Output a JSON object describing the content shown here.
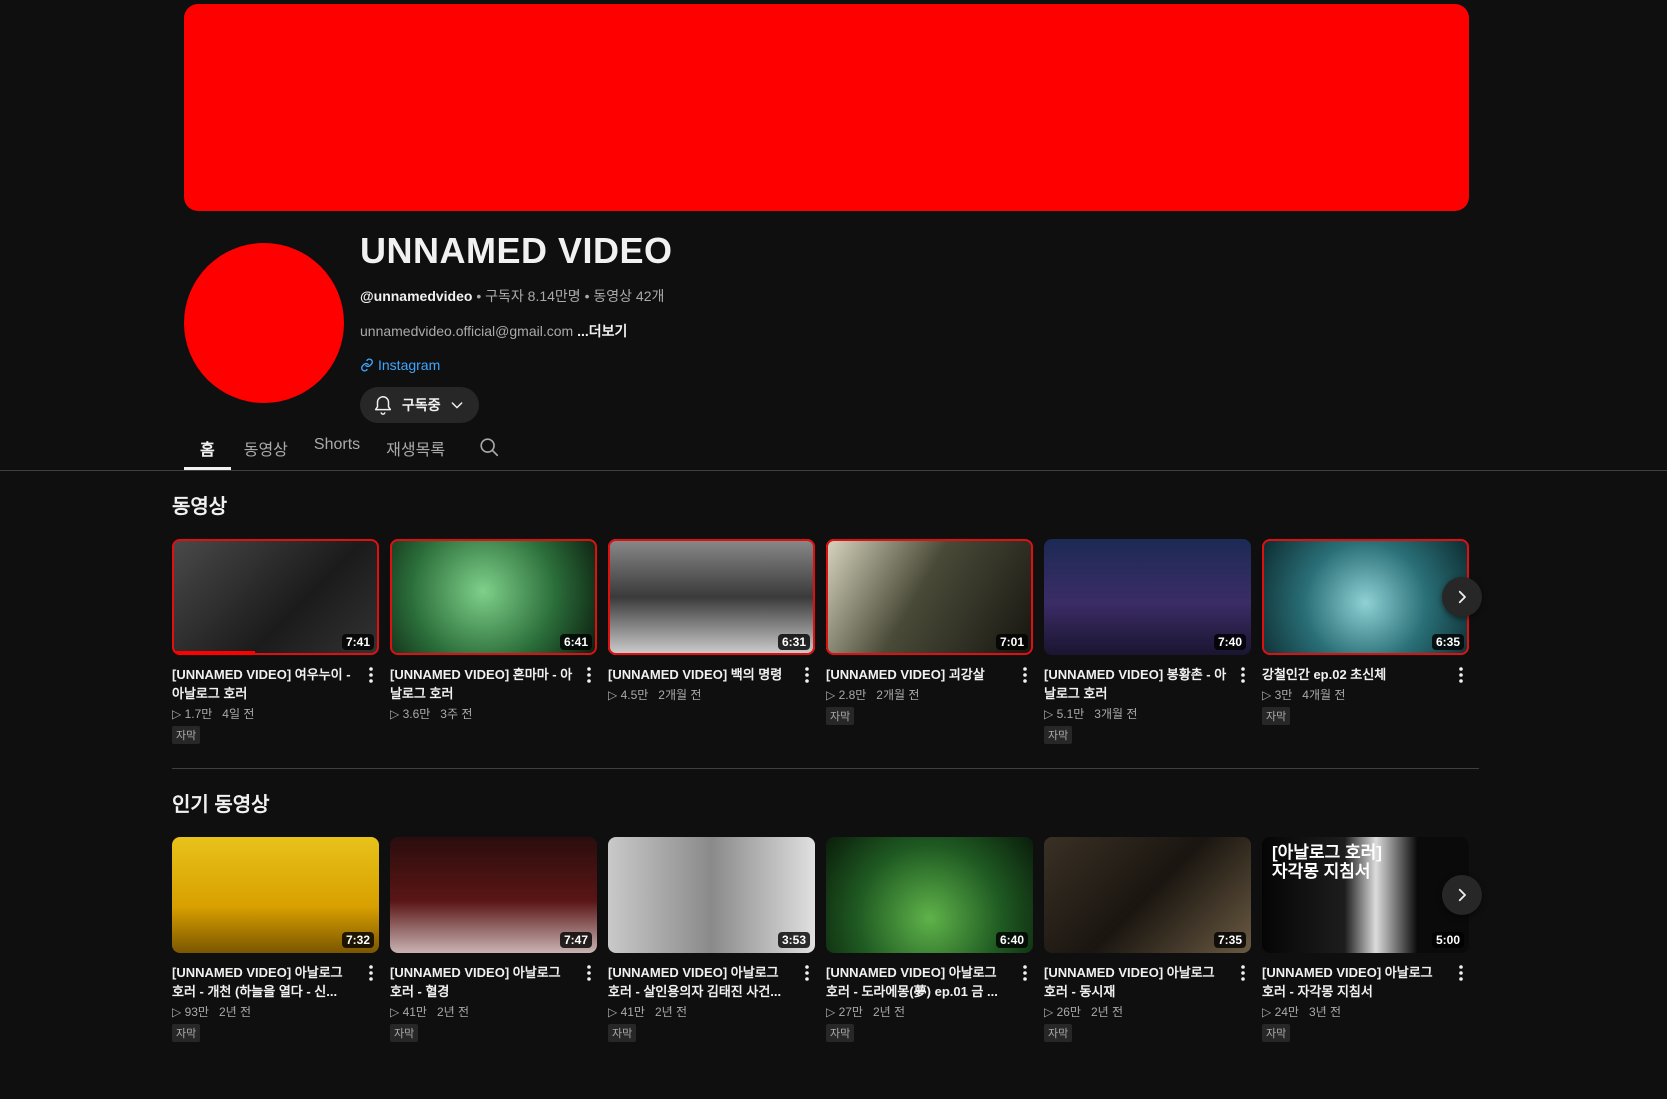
{
  "colors": {
    "accent": "#ff0000",
    "link": "#3ea6ff",
    "bg": "#0f0f0f"
  },
  "channel": {
    "name": "UNNAMED VIDEO",
    "handle": "@unnamedvideo",
    "subscribers": "구독자 8.14만명",
    "video_count": "동영상 42개",
    "separator": "•",
    "description": "unnamedvideo.official@gmail.com",
    "more_label": "...더보기",
    "link_label": "Instagram",
    "subscribe_label": "구독중"
  },
  "tabs": [
    {
      "label": "홈",
      "active": true
    },
    {
      "label": "동영상",
      "active": false
    },
    {
      "label": "Shorts",
      "active": false
    },
    {
      "label": "재생목록",
      "active": false
    }
  ],
  "sections": [
    {
      "title": "동영상",
      "videos": [
        {
          "title": "[UNNAMED VIDEO] 여우누이 - 아날로그 호러",
          "views": "▷ 1.7만",
          "age": "4일 전",
          "duration": "7:41",
          "badge": "자막",
          "watched": true,
          "progress": 0.4,
          "thumb": "linear-gradient(135deg,#4a4a4a,#1b1b1b 60%,#333)"
        },
        {
          "title": "[UNNAMED VIDEO] 혼마마 - 아날로그 호러",
          "views": "▷ 3.6만",
          "age": "3주 전",
          "duration": "6:41",
          "badge": "",
          "watched": true,
          "progress": 0.0,
          "thumb": "radial-gradient(circle at 45% 45%,#7fd08a,#2b6e3a 55%,#0b1a0e)"
        },
        {
          "title": "[UNNAMED VIDEO] 백의 명령",
          "views": "▷ 4.5만",
          "age": "2개월 전",
          "duration": "6:31",
          "badge": "",
          "watched": true,
          "progress": 0.0,
          "thumb": "linear-gradient(180deg,#8a8a8a,#3a3a3a 50%,#cfcfcf)"
        },
        {
          "title": "[UNNAMED VIDEO] 괴강살",
          "views": "▷ 2.8만",
          "age": "2개월 전",
          "duration": "7:01",
          "badge": "자막",
          "watched": true,
          "progress": 0.0,
          "thumb": "linear-gradient(120deg,#d8d6c0,#4a4a38 45%,#151510)"
        },
        {
          "title": "[UNNAMED VIDEO] 봉황촌 - 아날로그 호러",
          "views": "▷ 5.1만",
          "age": "3개월 전",
          "duration": "7:40",
          "badge": "자막",
          "watched": false,
          "progress": 0.0,
          "thumb": "linear-gradient(180deg,#1c2a55,#3b2c66 55%,#1a1530)"
        },
        {
          "title": "강철인간 ep.02 초신체",
          "views": "▷ 3만",
          "age": "4개월 전",
          "duration": "6:35",
          "badge": "자막",
          "watched": true,
          "progress": 0.0,
          "thumb": "radial-gradient(circle at 50% 55%,#8fd1d4,#2a6f77 50%,#0c2a2e)"
        }
      ]
    },
    {
      "title": "인기 동영상",
      "videos": [
        {
          "title": "[UNNAMED VIDEO] 아날로그 호러 - 개천 (하늘을 열다 - 신...",
          "views": "▷ 93만",
          "age": "2년 전",
          "duration": "7:32",
          "badge": "자막",
          "watched": false,
          "progress": 0.0,
          "thumb": "linear-gradient(180deg,#e8c21a,#d8a000 60%,#7a5600)"
        },
        {
          "title": "[UNNAMED VIDEO] 아날로그 호러 - 혈경",
          "views": "▷ 41만",
          "age": "2년 전",
          "duration": "7:47",
          "badge": "자막",
          "watched": false,
          "progress": 0.0,
          "thumb": "linear-gradient(180deg,#2a0d0d,#5a1515 55%,#c9b3b3)"
        },
        {
          "title": "[UNNAMED VIDEO] 아날로그 호러 - 살인용의자 김태진 사건...",
          "views": "▷ 41만",
          "age": "2년 전",
          "duration": "3:53",
          "badge": "자막",
          "watched": false,
          "progress": 0.0,
          "thumb": "linear-gradient(90deg,#c9c9c9,#8a8a8a 50%,#e0e0e0)"
        },
        {
          "title": "[UNNAMED VIDEO] 아날로그 호러 - 도라에몽(夢) ep.01 금 ...",
          "views": "▷ 27만",
          "age": "2년 전",
          "duration": "6:40",
          "badge": "자막",
          "watched": false,
          "progress": 0.0,
          "thumb": "radial-gradient(circle at 50% 70%,#5fb34a,#1f5a22 55%,#0a1c0a)"
        },
        {
          "title": "[UNNAMED VIDEO] 아날로그 호러 - 동시재",
          "views": "▷ 26만",
          "age": "2년 전",
          "duration": "7:35",
          "badge": "자막",
          "watched": false,
          "progress": 0.0,
          "thumb": "linear-gradient(135deg,#3a3125,#1a1510 50%,#6a5a42)"
        },
        {
          "title": "[UNNAMED VIDEO] 아날로그 호러 - 자각몽 지침서",
          "views": "▷ 24만",
          "age": "3년 전",
          "duration": "5:00",
          "badge": "자막",
          "watched": false,
          "progress": 0.0,
          "thumb": "linear-gradient(90deg,#050505,#1d1d1d 40%,#dcdcdc 55%,#0a0a0a 75%)",
          "thumb_text": "[아날로그 호러]\n자각몽 지침서"
        }
      ]
    }
  ]
}
